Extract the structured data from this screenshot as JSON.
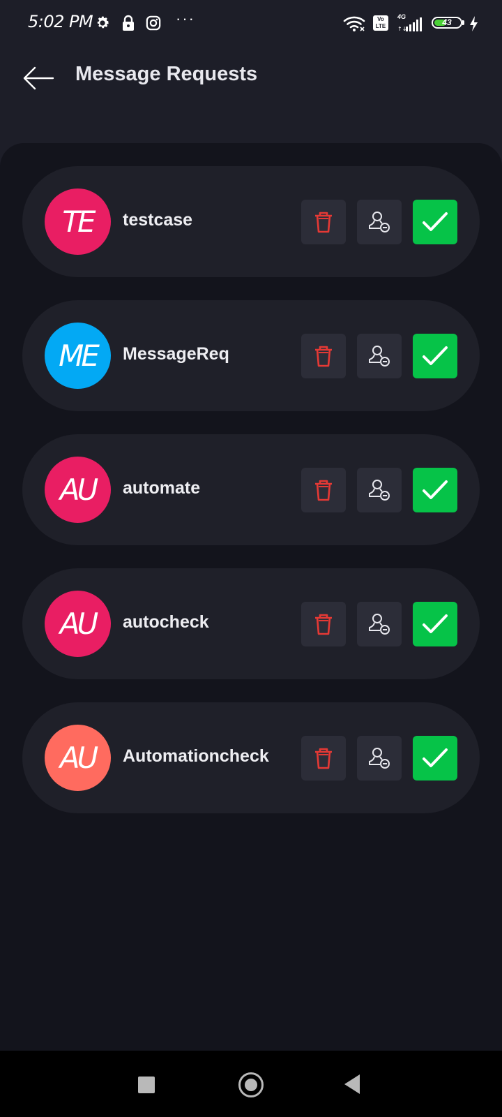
{
  "status_bar": {
    "time": "5:02 PM",
    "battery_level": "43",
    "network_type": "4G",
    "volte_label": "Vo LTE",
    "icons": [
      "settings-icon",
      "lock-icon",
      "instagram-icon",
      "more-dots-icon",
      "wifi-icon",
      "volte-icon",
      "signal-icon",
      "battery-icon",
      "charging-icon"
    ],
    "more_label": "···"
  },
  "header": {
    "title": "Message Requests",
    "back_icon": "back-arrow-icon"
  },
  "requests": [
    {
      "initials": "TE",
      "name": "testcase",
      "avatar_color": "#e91e63"
    },
    {
      "initials": "ME",
      "name": "MessageReq",
      "avatar_color": "#03a9f4"
    },
    {
      "initials": "AU",
      "name": "automate",
      "avatar_color": "#e91e63"
    },
    {
      "initials": "AU",
      "name": "autocheck",
      "avatar_color": "#e91e63"
    },
    {
      "initials": "AU",
      "name": "Automationcheck",
      "avatar_color": "#ff6b5f"
    }
  ],
  "actions": {
    "delete_icon": "trash-icon",
    "block_icon": "remove-user-icon",
    "accept_icon": "checkmark-icon"
  },
  "colors": {
    "accept": "#06c348",
    "delete": "#e53935",
    "background": "#13141c",
    "card": "#1f2029"
  },
  "nav_bar": {
    "icons": [
      "recents-square-icon",
      "home-circle-icon",
      "back-triangle-icon"
    ]
  }
}
